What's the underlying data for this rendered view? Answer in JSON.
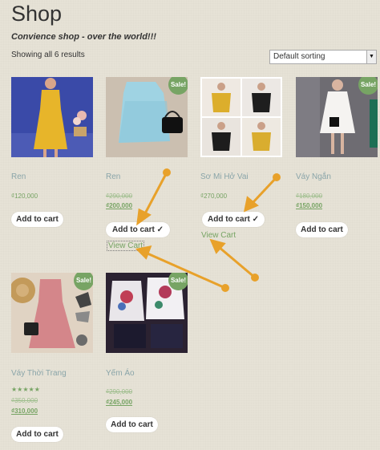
{
  "page": {
    "title": "Shop",
    "tagline": "Convience shop - over the world!!!",
    "result_count": "Showing all 6 results"
  },
  "sorting": {
    "selected": "Default sorting"
  },
  "labels": {
    "sale": "Sale!",
    "view_cart": "View Cart"
  },
  "products": [
    {
      "name": "Ren",
      "price": "₫120,000",
      "button": "Add to cart"
    },
    {
      "name": "Ren",
      "old_price": "₫290,000",
      "price": "₫200,000",
      "button": "Add to cart",
      "added": true,
      "check": "✓"
    },
    {
      "name": "Sơ Mi Hở Vai",
      "price": "₫270,000",
      "button": "Add to cart",
      "added": true,
      "check": "✓"
    },
    {
      "name": "Váy Ngắn",
      "old_price": "₫180,000",
      "price": "₫150,000",
      "button": "Add to cart"
    },
    {
      "name": "Váy Thời Trang",
      "rating": 5,
      "old_price": "₫350,000",
      "price": "₫310,000",
      "button": "Add to cart"
    },
    {
      "name": "Yếm Áo",
      "old_price": "₫290,000",
      "price": "₫245,000",
      "button": "Add to cart"
    }
  ],
  "colors": {
    "accent": "#77a464",
    "product_name": "#8aa5a9",
    "annotation_arrow": "#e8a12a"
  }
}
